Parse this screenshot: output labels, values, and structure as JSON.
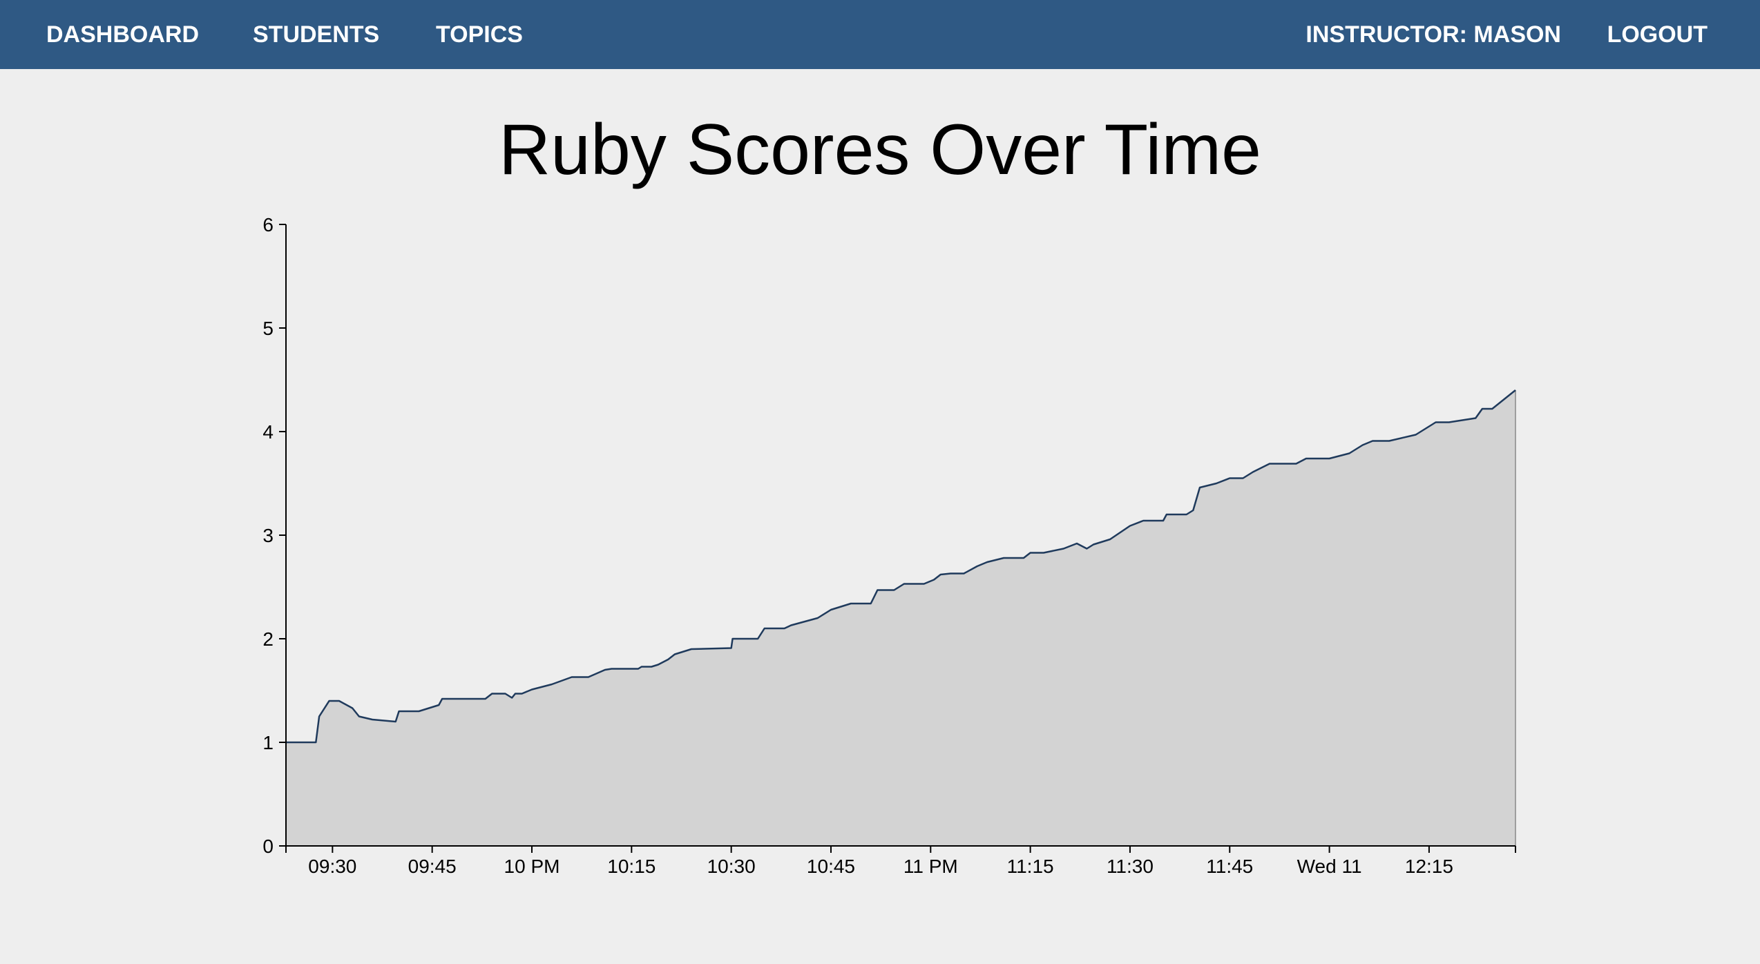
{
  "nav": {
    "dashboard": "DASHBOARD",
    "students": "STUDENTS",
    "topics": "TOPICS",
    "instructor": "INSTRUCTOR: MASON",
    "logout": "LOGOUT"
  },
  "colors": {
    "navbar": "#2f5984",
    "background": "#eeeeee",
    "area_fill": "#d3d3d3",
    "line": "#1f3a5c"
  },
  "chart_data": {
    "type": "area",
    "title": "Ruby Scores Over Time",
    "xlabel": "",
    "ylabel": "",
    "ylim": [
      0,
      6
    ],
    "yticks": [
      "0",
      "1",
      "2",
      "3",
      "4",
      "5",
      "6"
    ],
    "xlim": [
      "09:23",
      "12:28"
    ],
    "xticks": [
      "09:30",
      "09:45",
      "10 PM",
      "10:15",
      "10:30",
      "10:45",
      "11 PM",
      "11:15",
      "11:30",
      "11:45",
      "Wed 11",
      "12:15"
    ],
    "grid": false,
    "legend": "none",
    "points": [
      [
        "09:23",
        1.0
      ],
      [
        "09:27.5",
        1.0
      ],
      [
        "09:28",
        1.25
      ],
      [
        "09:29.5",
        1.4
      ],
      [
        "09:31",
        1.4
      ],
      [
        "09:33",
        1.33
      ],
      [
        "09:34",
        1.25
      ],
      [
        "09:36",
        1.22
      ],
      [
        "09:39.5",
        1.2
      ],
      [
        "09:40",
        1.3
      ],
      [
        "09:43",
        1.3
      ],
      [
        "09:46",
        1.36
      ],
      [
        "09:46.5",
        1.42
      ],
      [
        "09:53",
        1.42
      ],
      [
        "09:54",
        1.47
      ],
      [
        "09:56",
        1.47
      ],
      [
        "09:57",
        1.43
      ],
      [
        "09:57.5",
        1.47
      ],
      [
        "09:58.5",
        1.47
      ],
      [
        "10:00",
        1.51
      ],
      [
        "10:03",
        1.56
      ],
      [
        "10:06",
        1.63
      ],
      [
        "10:08.5",
        1.63
      ],
      [
        "10:11",
        1.7
      ],
      [
        "10:12",
        1.71
      ],
      [
        "10:16",
        1.71
      ],
      [
        "10:16.5",
        1.73
      ],
      [
        "10:18",
        1.73
      ],
      [
        "10:19",
        1.75
      ],
      [
        "10:20.5",
        1.8
      ],
      [
        "10:21.5",
        1.85
      ],
      [
        "10:24",
        1.9
      ],
      [
        "10:30",
        1.91
      ],
      [
        "10:30.2",
        2.0
      ],
      [
        "10:34",
        2.0
      ],
      [
        "10:35",
        2.1
      ],
      [
        "10:38",
        2.1
      ],
      [
        "10:39",
        2.13
      ],
      [
        "10:43",
        2.2
      ],
      [
        "10:45",
        2.28
      ],
      [
        "10:48",
        2.34
      ],
      [
        "10:51",
        2.34
      ],
      [
        "10:52",
        2.47
      ],
      [
        "10:54.5",
        2.47
      ],
      [
        "10:56",
        2.53
      ],
      [
        "10:59",
        2.53
      ],
      [
        "11:00.5",
        2.57
      ],
      [
        "11:01.5",
        2.62
      ],
      [
        "11:03",
        2.63
      ],
      [
        "11:05",
        2.63
      ],
      [
        "11:07",
        2.7
      ],
      [
        "11:08.5",
        2.74
      ],
      [
        "11:11",
        2.78
      ],
      [
        "11:14",
        2.78
      ],
      [
        "11:15",
        2.83
      ],
      [
        "11:17",
        2.83
      ],
      [
        "11:20",
        2.87
      ],
      [
        "11:22",
        2.92
      ],
      [
        "11:23.5",
        2.87
      ],
      [
        "11:24.5",
        2.91
      ],
      [
        "11:27",
        2.96
      ],
      [
        "11:30",
        3.09
      ],
      [
        "11:32",
        3.14
      ],
      [
        "11:35",
        3.14
      ],
      [
        "11:35.5",
        3.2
      ],
      [
        "11:38.5",
        3.2
      ],
      [
        "11:39.5",
        3.24
      ],
      [
        "11:40",
        3.35
      ],
      [
        "11:40.5",
        3.46
      ],
      [
        "11:43",
        3.5
      ],
      [
        "11:45",
        3.55
      ],
      [
        "11:47",
        3.55
      ],
      [
        "11:48.5",
        3.61
      ],
      [
        "11:51",
        3.69
      ],
      [
        "11:55",
        3.69
      ],
      [
        "11:56.5",
        3.74
      ],
      [
        "12:00",
        3.74
      ],
      [
        "12:03",
        3.79
      ],
      [
        "12:05",
        3.87
      ],
      [
        "12:06.5",
        3.91
      ],
      [
        "12:09",
        3.91
      ],
      [
        "12:13",
        3.97
      ],
      [
        "12:16",
        4.09
      ],
      [
        "12:18",
        4.09
      ],
      [
        "12:22",
        4.13
      ],
      [
        "12:23",
        4.22
      ],
      [
        "12:24.5",
        4.22
      ],
      [
        "12:28",
        4.4
      ]
    ]
  }
}
